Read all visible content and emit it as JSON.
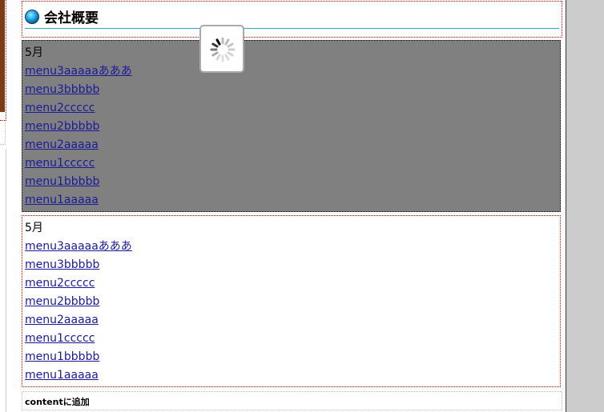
{
  "page": {
    "title": "会社概要"
  },
  "lists": [
    {
      "month": "5月",
      "items": [
        "menu3aaaaaあああ",
        "menu3bbbbb",
        "menu2ccccc",
        "menu2bbbbb",
        "menu2aaaaa",
        "menu1ccccc",
        "menu1bbbbb",
        "menu1aaaaa"
      ]
    },
    {
      "month": "5月",
      "items": [
        "menu3aaaaaあああ",
        "menu3bbbbb",
        "menu2ccccc",
        "menu2bbbbb",
        "menu2aaaaa",
        "menu1ccccc",
        "menu1bbbbb",
        "menu1aaaaa"
      ]
    }
  ],
  "footer": {
    "add_label": "contentに追加"
  },
  "icons": {
    "title": "globe-icon",
    "loading": "loading-spinner-icon"
  },
  "colors": {
    "link": "#1a1a9a",
    "highlight_bg": "#808080",
    "rule": "#29a9c9",
    "border": "#cc0000"
  }
}
